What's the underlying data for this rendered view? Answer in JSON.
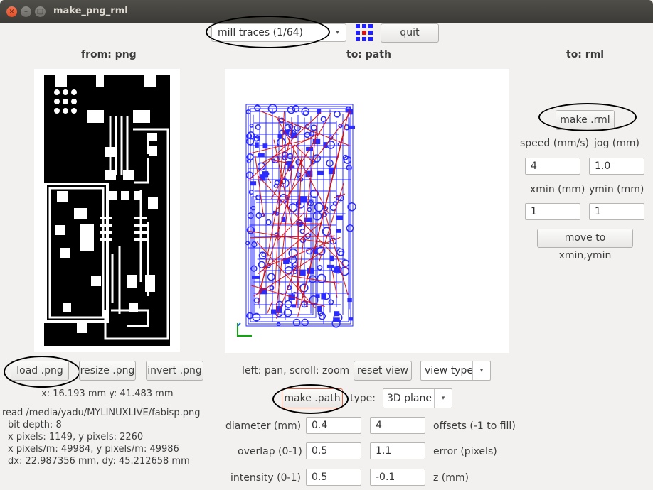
{
  "window": {
    "title": "make_png_rml",
    "close_glyph": "×",
    "min_glyph": "–",
    "max_glyph": "□"
  },
  "toolbar": {
    "process_select": "mill traces (1/64)",
    "quit_label": "quit",
    "dropdown_arrow": "▾"
  },
  "headers": {
    "from": "from: png",
    "to_path": "to: path",
    "to_rml": "to: rml"
  },
  "left": {
    "load_label": "load .png",
    "resize_label": "resize .png",
    "invert_label": "invert .png",
    "coords": "x: 16.193 mm  y: 41.483 mm",
    "info": [
      "read /media/yadu/MYLINUXLIVE/fabisp.png",
      "bit depth: 8",
      "x pixels: 1149, y pixels: 2260",
      "x pixels/m: 49984, y pixels/m: 49986",
      "dx: 22.987356 mm, dy: 45.212658 mm"
    ]
  },
  "middle": {
    "hint": "left: pan, scroll: zoom",
    "reset_view_label": "reset view",
    "view_type_value": "view type",
    "make_path_label": "make .path",
    "type_label": "type:",
    "type_value": "3D plane",
    "params": [
      {
        "label": "diameter (mm)",
        "value": "0.4",
        "value2": "4",
        "label2": "offsets (-1 to fill)"
      },
      {
        "label": "overlap (0-1)",
        "value": "0.5",
        "value2": "1.1",
        "label2": "error (pixels)"
      },
      {
        "label": "intensity (0-1)",
        "value": "0.5",
        "value2": "-0.1",
        "label2": "z (mm)"
      }
    ]
  },
  "right": {
    "make_rml_label": "make .rml",
    "speed_label": "speed (mm/s)",
    "jog_label": "jog (mm)",
    "speed_value": "4",
    "jog_value": "1.0",
    "xmin_label": "xmin (mm)",
    "ymin_label": "ymin (mm)",
    "xmin_value": "1",
    "ymin_value": "1",
    "move_label": "move to xmin,ymin"
  },
  "colors": {
    "path_blue": "#2b2bff",
    "path_red": "#dd1111",
    "titlebar": "#3c3b37",
    "close_orange": "#e0512a"
  }
}
